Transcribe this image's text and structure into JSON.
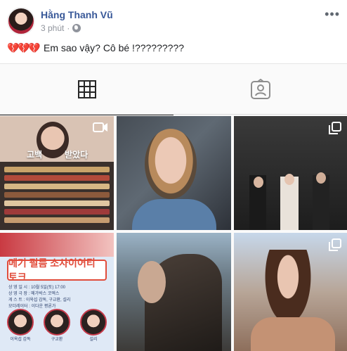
{
  "post": {
    "author": "Hằng Thanh Vũ",
    "time": "3 phút",
    "time_separator": "·",
    "more_label": "•••",
    "text": "Em sao vậy? Cô bé !?????????",
    "hearts": [
      "💔",
      "💔",
      "💔"
    ],
    "icons": {
      "avatar": "avatar-image",
      "privacy": "globe-icon",
      "more": "more-dots-icon"
    }
  },
  "embed": {
    "tabs": [
      {
        "name": "posts-grid",
        "icon": "grid-icon",
        "active": true
      },
      {
        "name": "tagged",
        "icon": "tagged-person-icon",
        "active": false
      }
    ],
    "tiles": [
      {
        "type": "video",
        "overlay_left": "고백",
        "overlay_right": "받았다",
        "icon": "video-camera-icon"
      },
      {
        "type": "photo"
      },
      {
        "type": "carousel",
        "icon": "multiple-photos-icon"
      },
      {
        "type": "poster",
        "title": "메기  펄름 소사이어티 토크",
        "info_lines": [
          "상 영 일 시 : 10월 5일(토) 17:00",
          "상 영 극 장 : 메가박스 코엑스",
          "게 스 트 : 이옥섭 감독, 구교환, 설리",
          "모더레이터 : 이다운 평론가"
        ],
        "guests": [
          "이옥섭 감독",
          "구교환",
          "설리"
        ]
      },
      {
        "type": "photo"
      },
      {
        "type": "carousel",
        "icon": "multiple-photos-icon"
      }
    ]
  },
  "colors": {
    "author": "#385898",
    "meta": "#90949c",
    "heart": "#e37b96",
    "poster_accent": "#e14c3b",
    "poster_text": "#2b3f6b"
  }
}
